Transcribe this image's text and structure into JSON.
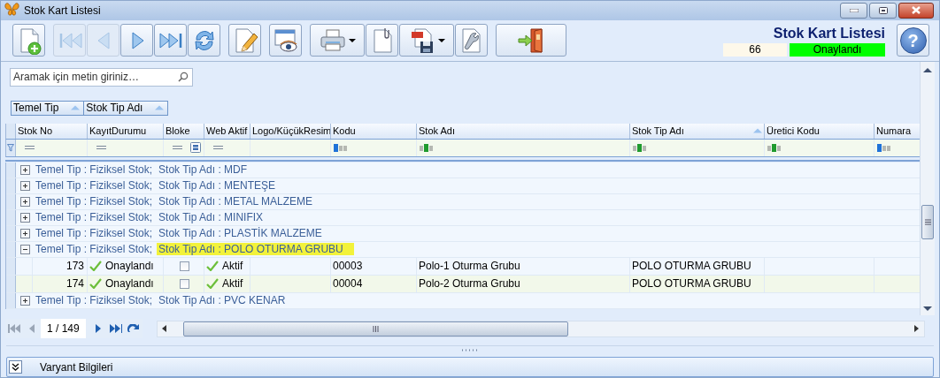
{
  "window": {
    "title": "Stok Kart Listesi"
  },
  "toolbar": {
    "groups": [
      [
        {
          "kind": "new",
          "disabled": false
        }
      ],
      [
        {
          "kind": "first",
          "disabled": true
        },
        {
          "kind": "prev",
          "disabled": true
        },
        {
          "kind": "next",
          "disabled": false
        },
        {
          "kind": "last",
          "disabled": false
        },
        {
          "kind": "refresh",
          "disabled": false
        }
      ],
      [
        {
          "kind": "edit",
          "disabled": false
        }
      ],
      [
        {
          "kind": "preview",
          "disabled": false
        }
      ],
      [
        {
          "kind": "print",
          "disabled": false,
          "dropdown": true
        },
        {
          "kind": "attach",
          "disabled": false
        },
        {
          "kind": "pdf",
          "disabled": false,
          "dropdown": true
        },
        {
          "kind": "tools",
          "disabled": false
        }
      ],
      [
        {
          "kind": "exit",
          "disabled": false
        }
      ]
    ]
  },
  "header": {
    "title": "Stok Kart Listesi",
    "record_no": "66",
    "status": "Onaylandı",
    "help_symbol": "?"
  },
  "search": {
    "placeholder": "Aramak için metin giriniz…"
  },
  "group_by": [
    {
      "label": "Temel Tip",
      "sorted": true
    },
    {
      "label": "Stok Tip Adı",
      "sorted": true
    }
  ],
  "table": {
    "columns": [
      {
        "label": "Stok No",
        "sorted": false
      },
      {
        "label": "KayıtDurumu",
        "sorted": false
      },
      {
        "label": "Bloke",
        "sorted": false
      },
      {
        "label": "Web Aktif",
        "sorted": false
      },
      {
        "label": "Logo/KüçükResim",
        "sorted": false
      },
      {
        "label": "Kodu",
        "sorted": false
      },
      {
        "label": "Stok Adı",
        "sorted": false
      },
      {
        "label": "Stok Tip Adı",
        "sorted": true
      },
      {
        "label": "Üretici Kodu",
        "sorted": false
      },
      {
        "label": "Numara",
        "sorted": false
      }
    ],
    "filters": [
      {
        "kind": "equals"
      },
      {
        "kind": "equals"
      },
      {
        "kind": "equals-check"
      },
      {
        "kind": "equals"
      },
      {
        "kind": "blank"
      },
      {
        "kind": "begins"
      },
      {
        "kind": "contains"
      },
      {
        "kind": "contains"
      },
      {
        "kind": "contains"
      },
      {
        "kind": "begins"
      }
    ],
    "groups": [
      {
        "temel_tip": "Temel Tip : Fiziksel Stok;",
        "stok_tip": "Stok Tip Adı : MDF",
        "expanded": false,
        "highlighted": false
      },
      {
        "temel_tip": "Temel Tip : Fiziksel Stok;",
        "stok_tip": "Stok Tip Adı : MENTEŞE",
        "expanded": false,
        "highlighted": false
      },
      {
        "temel_tip": "Temel Tip : Fiziksel Stok;",
        "stok_tip": "Stok Tip Adı : METAL MALZEME",
        "expanded": false,
        "highlighted": false
      },
      {
        "temel_tip": "Temel Tip : Fiziksel Stok;",
        "stok_tip": "Stok Tip Adı : MINIFIX",
        "expanded": false,
        "highlighted": false
      },
      {
        "temel_tip": "Temel Tip : Fiziksel Stok;",
        "stok_tip": "Stok Tip Adı : PLASTİK MALZEME",
        "expanded": false,
        "highlighted": false
      },
      {
        "temel_tip": "Temel Tip : Fiziksel Stok;",
        "stok_tip": "Stok Tip Adı : POLO OTURMA GRUBU",
        "expanded": true,
        "highlighted": true,
        "rows": [
          {
            "stok_no": "173",
            "kayit_durumu": "Onaylandı",
            "approved": true,
            "bloke": false,
            "web_aktif": "Aktif",
            "web_aktif_on": true,
            "kodu": "00003",
            "stok_adi": "Polo-1 Oturma Grubu",
            "stok_tip_adi": "POLO OTURMA GRUBU"
          },
          {
            "stok_no": "174",
            "kayit_durumu": "Onaylandı",
            "approved": true,
            "bloke": false,
            "web_aktif": "Aktif",
            "web_aktif_on": true,
            "kodu": "00004",
            "stok_adi": "Polo-2 Oturma Grubu",
            "stok_tip_adi": "POLO OTURMA GRUBU"
          }
        ]
      },
      {
        "temel_tip": "Temel Tip : Fiziksel Stok;",
        "stok_tip": "Stok Tip Adı : PVC KENAR",
        "expanded": false,
        "highlighted": false
      }
    ]
  },
  "pager": {
    "position": "1 / 149",
    "buttons": [
      {
        "kind": "first",
        "disabled": true
      },
      {
        "kind": "prev",
        "disabled": true
      },
      {
        "kind": "next",
        "disabled": false
      },
      {
        "kind": "last",
        "disabled": false
      },
      {
        "kind": "refresh",
        "disabled": false
      }
    ]
  },
  "footer": {
    "panels": [
      {
        "label": "Varyant Bilgileri",
        "expanded": false
      }
    ]
  }
}
